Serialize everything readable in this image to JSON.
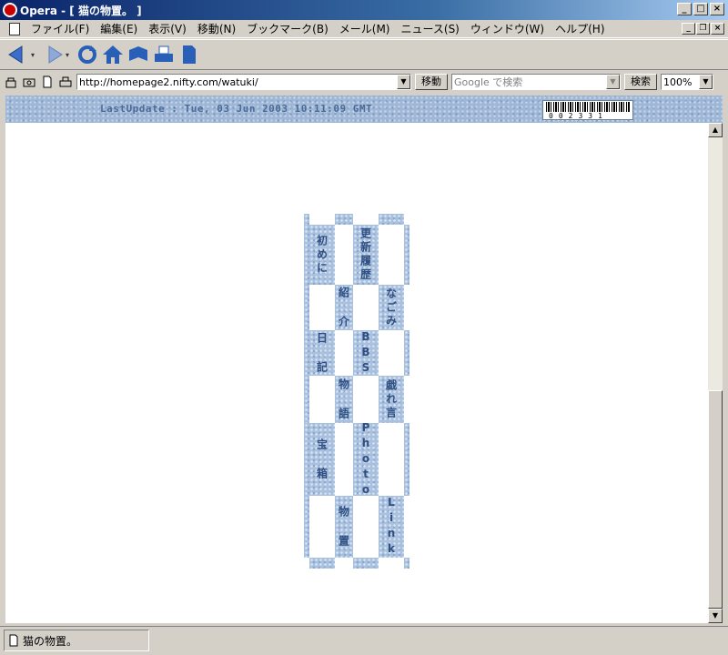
{
  "window": {
    "title": "Opera - [ 猫の物置。 ]"
  },
  "menu": {
    "items": [
      "ファイル(F)",
      "編集(E)",
      "表示(V)",
      "移動(N)",
      "ブックマーク(B)",
      "メール(M)",
      "ニュース(S)",
      "ウィンドウ(W)",
      "ヘルプ(H)"
    ]
  },
  "toolbar": {
    "buttons": [
      "back-icon",
      "forward-icon",
      "reload-icon",
      "home-icon",
      "hotlist-icon",
      "print-icon",
      "document-icon"
    ]
  },
  "address": {
    "url": "http://homepage2.nifty.com/watuki/",
    "go_label": "移動",
    "search_placeholder": "Google で検索",
    "search_label": "検索",
    "zoom": "100%"
  },
  "page": {
    "last_update": "LastUpdate : Tue, 03 Jun 2003 10:11:09 GMT",
    "counter": "002331",
    "nav": [
      {
        "id": "hajimeni",
        "label": "初めに"
      },
      {
        "id": "koushin",
        "label": "更新履歴"
      },
      {
        "id": "shoukai",
        "label": "紹 介"
      },
      {
        "id": "nagomi",
        "label": "なごみ"
      },
      {
        "id": "nikki",
        "label": "日 記"
      },
      {
        "id": "bbs",
        "label": "BBS"
      },
      {
        "id": "monogatari",
        "label": "物 語"
      },
      {
        "id": "zaregoto",
        "label": "戯れ言"
      },
      {
        "id": "takarabako",
        "label": "宝 箱"
      },
      {
        "id": "photo",
        "label": "Photo"
      },
      {
        "id": "monooki",
        "label": "物 置"
      },
      {
        "id": "link",
        "label": "Link"
      }
    ]
  },
  "status": {
    "text": "猫の物置。"
  },
  "colors": {
    "accent": "#2f4f82",
    "tile": "#a9c1df",
    "titlebar": "#0a246a"
  }
}
